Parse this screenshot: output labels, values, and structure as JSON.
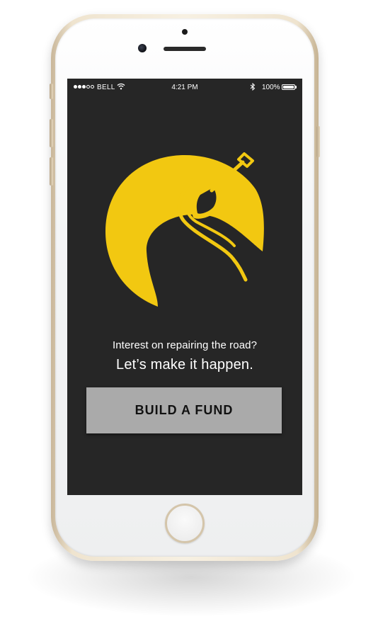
{
  "status_bar": {
    "carrier": "BELL",
    "time": "4:21 PM",
    "battery_percent": "100%",
    "battery_level": 1.0,
    "signal_bars_filled": 3,
    "signal_bars_total": 5,
    "wifi_icon": "wifi-icon",
    "bluetooth_icon": "bluetooth-icon"
  },
  "logo": {
    "icon": "road-shovel-logo-icon",
    "color": "#F2C811"
  },
  "main": {
    "tagline": "Interest on repairing the road?",
    "headline": "Let’s make it happen.",
    "cta_label": "BUILD A FUND"
  },
  "colors": {
    "screen_background": "#262626",
    "accent": "#F2C811",
    "button_background": "#AAAAAA",
    "button_text": "#111111"
  }
}
